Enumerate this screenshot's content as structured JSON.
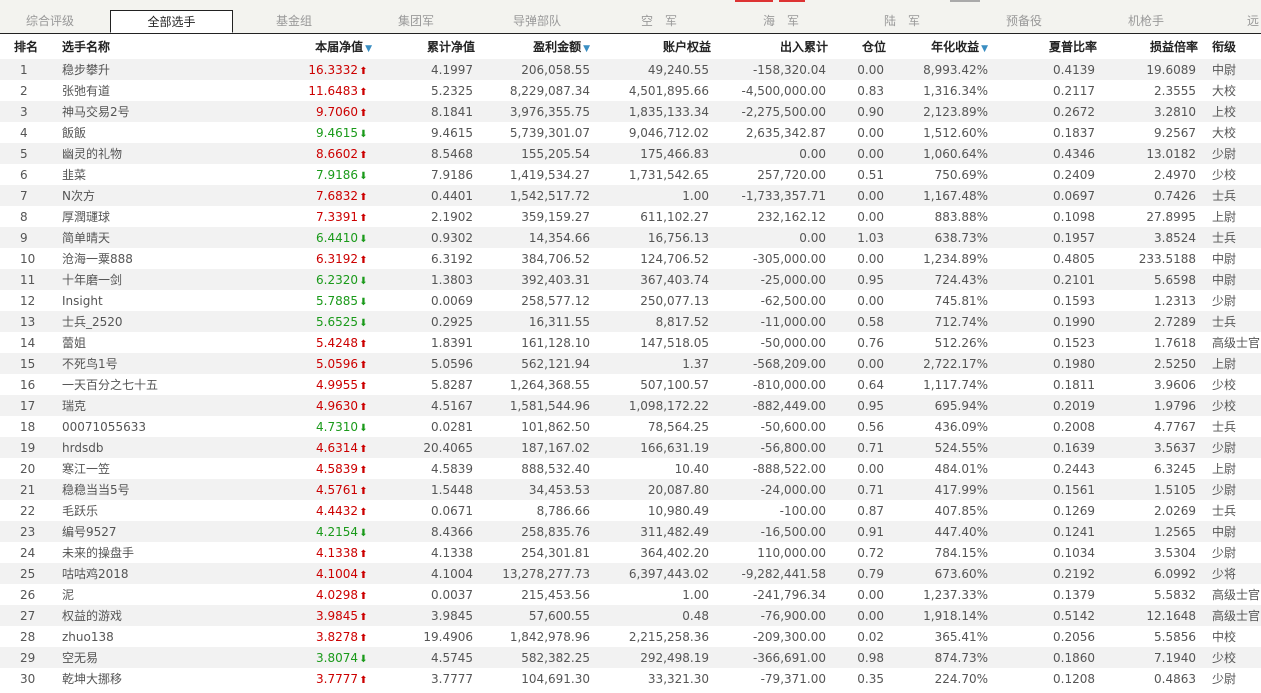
{
  "tabs": [
    {
      "label": "综合评级",
      "active": false
    },
    {
      "label": "全部选手",
      "active": true
    },
    {
      "label": "基金组",
      "active": false
    },
    {
      "label": "集团军",
      "active": false
    },
    {
      "label": "导弹部队",
      "active": false
    },
    {
      "label": "空　军",
      "active": false
    },
    {
      "label": "海　军",
      "active": false
    },
    {
      "label": "陆　军",
      "active": false
    },
    {
      "label": "预备役",
      "active": false
    },
    {
      "label": "机枪手",
      "active": false
    },
    {
      "label": "远",
      "active": false
    }
  ],
  "headers": {
    "rank": "排名",
    "name": "选手名称",
    "nav": "本届净值",
    "cum_nav": "累计净值",
    "profit": "盈利金额",
    "equity": "账户权益",
    "flow": "出入累计",
    "position": "仓位",
    "annual": "年化收益",
    "sharpe": "夏普比率",
    "ratio": "损益倍率",
    "grade": "衔级"
  },
  "colors": {
    "up": "#cc0000",
    "down": "#1a9a1a",
    "sort_icon": "#3a8ec2",
    "row_stripe": "#f2f2f2"
  },
  "rows": [
    {
      "rank": "1",
      "name": "稳步攀升",
      "nav": "16.3332",
      "dir": "up",
      "cum": "4.1997",
      "profit": "206,058.55",
      "equity": "49,240.55",
      "flow": "-158,320.04",
      "pos": "0.00",
      "annual": "8,993.42%",
      "sharpe": "0.4139",
      "ratio": "19.6089",
      "grade": "中尉"
    },
    {
      "rank": "2",
      "name": "张弛有道",
      "nav": "11.6483",
      "dir": "up",
      "cum": "5.2325",
      "profit": "8,229,087.34",
      "equity": "4,501,895.66",
      "flow": "-4,500,000.00",
      "pos": "0.83",
      "annual": "1,316.34%",
      "sharpe": "0.2117",
      "ratio": "2.3555",
      "grade": "大校"
    },
    {
      "rank": "3",
      "name": "神马交易2号",
      "nav": "9.7060",
      "dir": "up",
      "cum": "8.1841",
      "profit": "3,976,355.75",
      "equity": "1,835,133.34",
      "flow": "-2,275,500.00",
      "pos": "0.90",
      "annual": "2,123.89%",
      "sharpe": "0.2672",
      "ratio": "3.2810",
      "grade": "上校"
    },
    {
      "rank": "4",
      "name": "飯飯",
      "nav": "9.4615",
      "dir": "down",
      "cum": "9.4615",
      "profit": "5,739,301.07",
      "equity": "9,046,712.02",
      "flow": "2,635,342.87",
      "pos": "0.00",
      "annual": "1,512.60%",
      "sharpe": "0.1837",
      "ratio": "9.2567",
      "grade": "大校"
    },
    {
      "rank": "5",
      "name": "幽灵的礼物",
      "nav": "8.6602",
      "dir": "up",
      "cum": "8.5468",
      "profit": "155,205.54",
      "equity": "175,466.83",
      "flow": "0.00",
      "pos": "0.00",
      "annual": "1,060.64%",
      "sharpe": "0.4346",
      "ratio": "13.0182",
      "grade": "少尉"
    },
    {
      "rank": "6",
      "name": "韭菜",
      "nav": "7.9186",
      "dir": "down",
      "cum": "7.9186",
      "profit": "1,419,534.27",
      "equity": "1,731,542.65",
      "flow": "257,720.00",
      "pos": "0.51",
      "annual": "750.69%",
      "sharpe": "0.2409",
      "ratio": "2.4970",
      "grade": "少校"
    },
    {
      "rank": "7",
      "name": "N次方",
      "nav": "7.6832",
      "dir": "up",
      "cum": "0.4401",
      "profit": "1,542,517.72",
      "equity": "1.00",
      "flow": "-1,733,357.71",
      "pos": "0.00",
      "annual": "1,167.48%",
      "sharpe": "0.0697",
      "ratio": "0.7426",
      "grade": "士兵"
    },
    {
      "rank": "8",
      "name": "厚潤璭球",
      "nav": "7.3391",
      "dir": "up",
      "cum": "2.1902",
      "profit": "359,159.27",
      "equity": "611,102.27",
      "flow": "232,162.12",
      "pos": "0.00",
      "annual": "883.88%",
      "sharpe": "0.1098",
      "ratio": "27.8995",
      "grade": "上尉"
    },
    {
      "rank": "9",
      "name": "简单晴天",
      "nav": "6.4410",
      "dir": "down",
      "cum": "0.9302",
      "profit": "14,354.66",
      "equity": "16,756.13",
      "flow": "0.00",
      "pos": "1.03",
      "annual": "638.73%",
      "sharpe": "0.1957",
      "ratio": "3.8524",
      "grade": "士兵"
    },
    {
      "rank": "10",
      "name": "沧海一粟888",
      "nav": "6.3192",
      "dir": "up",
      "cum": "6.3192",
      "profit": "384,706.52",
      "equity": "124,706.52",
      "flow": "-305,000.00",
      "pos": "0.00",
      "annual": "1,234.89%",
      "sharpe": "0.4805",
      "ratio": "233.5188",
      "grade": "中尉"
    },
    {
      "rank": "11",
      "name": "十年磨一剑",
      "nav": "6.2320",
      "dir": "down",
      "cum": "1.3803",
      "profit": "392,403.31",
      "equity": "367,403.74",
      "flow": "-25,000.00",
      "pos": "0.95",
      "annual": "724.43%",
      "sharpe": "0.2101",
      "ratio": "5.6598",
      "grade": "中尉"
    },
    {
      "rank": "12",
      "name": "Insight",
      "nav": "5.7885",
      "dir": "down",
      "cum": "0.0069",
      "profit": "258,577.12",
      "equity": "250,077.13",
      "flow": "-62,500.00",
      "pos": "0.00",
      "annual": "745.81%",
      "sharpe": "0.1593",
      "ratio": "1.2313",
      "grade": "少尉"
    },
    {
      "rank": "13",
      "name": "士兵_2520",
      "nav": "5.6525",
      "dir": "down",
      "cum": "0.2925",
      "profit": "16,311.55",
      "equity": "8,817.52",
      "flow": "-11,000.00",
      "pos": "0.58",
      "annual": "712.74%",
      "sharpe": "0.1990",
      "ratio": "2.7289",
      "grade": "士兵"
    },
    {
      "rank": "14",
      "name": "蕾姐",
      "nav": "5.4248",
      "dir": "up",
      "cum": "1.8391",
      "profit": "161,128.10",
      "equity": "147,518.05",
      "flow": "-50,000.00",
      "pos": "0.76",
      "annual": "512.26%",
      "sharpe": "0.1523",
      "ratio": "1.7618",
      "grade": "高级士官"
    },
    {
      "rank": "15",
      "name": "不死鸟1号",
      "nav": "5.0596",
      "dir": "up",
      "cum": "5.0596",
      "profit": "562,121.94",
      "equity": "1.37",
      "flow": "-568,209.00",
      "pos": "0.00",
      "annual": "2,722.17%",
      "sharpe": "0.1980",
      "ratio": "2.5250",
      "grade": "上尉"
    },
    {
      "rank": "16",
      "name": "一天百分之七十五",
      "nav": "4.9955",
      "dir": "up",
      "cum": "5.8287",
      "profit": "1,264,368.55",
      "equity": "507,100.57",
      "flow": "-810,000.00",
      "pos": "0.64",
      "annual": "1,117.74%",
      "sharpe": "0.1811",
      "ratio": "3.9606",
      "grade": "少校"
    },
    {
      "rank": "17",
      "name": "瑞克",
      "nav": "4.9630",
      "dir": "up",
      "cum": "4.5167",
      "profit": "1,581,544.96",
      "equity": "1,098,172.22",
      "flow": "-882,449.00",
      "pos": "0.95",
      "annual": "695.94%",
      "sharpe": "0.2019",
      "ratio": "1.9796",
      "grade": "少校"
    },
    {
      "rank": "18",
      "name": "00071055633",
      "nav": "4.7310",
      "dir": "down",
      "cum": "0.0281",
      "profit": "101,862.50",
      "equity": "78,564.25",
      "flow": "-50,600.00",
      "pos": "0.56",
      "annual": "436.09%",
      "sharpe": "0.2008",
      "ratio": "4.7767",
      "grade": "士兵"
    },
    {
      "rank": "19",
      "name": "hrdsdb",
      "nav": "4.6314",
      "dir": "up",
      "cum": "20.4065",
      "profit": "187,167.02",
      "equity": "166,631.19",
      "flow": "-56,800.00",
      "pos": "0.71",
      "annual": "524.55%",
      "sharpe": "0.1639",
      "ratio": "3.5637",
      "grade": "少尉"
    },
    {
      "rank": "20",
      "name": "寒江一笠",
      "nav": "4.5839",
      "dir": "up",
      "cum": "4.5839",
      "profit": "888,532.40",
      "equity": "10.40",
      "flow": "-888,522.00",
      "pos": "0.00",
      "annual": "484.01%",
      "sharpe": "0.2443",
      "ratio": "6.3245",
      "grade": "上尉"
    },
    {
      "rank": "21",
      "name": "稳稳当当5号",
      "nav": "4.5761",
      "dir": "up",
      "cum": "1.5448",
      "profit": "34,453.53",
      "equity": "20,087.80",
      "flow": "-24,000.00",
      "pos": "0.71",
      "annual": "417.99%",
      "sharpe": "0.1561",
      "ratio": "1.5105",
      "grade": "少尉"
    },
    {
      "rank": "22",
      "name": "毛跃乐",
      "nav": "4.4432",
      "dir": "up",
      "cum": "0.0671",
      "profit": "8,786.66",
      "equity": "10,980.49",
      "flow": "-100.00",
      "pos": "0.87",
      "annual": "407.85%",
      "sharpe": "0.1269",
      "ratio": "2.0269",
      "grade": "士兵"
    },
    {
      "rank": "23",
      "name": "编号9527",
      "nav": "4.2154",
      "dir": "down",
      "cum": "8.4366",
      "profit": "258,835.76",
      "equity": "311,482.49",
      "flow": "-16,500.00",
      "pos": "0.91",
      "annual": "447.40%",
      "sharpe": "0.1241",
      "ratio": "1.2565",
      "grade": "中尉"
    },
    {
      "rank": "24",
      "name": "未来的操盘手",
      "nav": "4.1338",
      "dir": "up",
      "cum": "4.1338",
      "profit": "254,301.81",
      "equity": "364,402.20",
      "flow": "110,000.00",
      "pos": "0.72",
      "annual": "784.15%",
      "sharpe": "0.1034",
      "ratio": "3.5304",
      "grade": "少尉"
    },
    {
      "rank": "25",
      "name": "咕咕鸡2018",
      "nav": "4.1004",
      "dir": "up",
      "cum": "4.1004",
      "profit": "13,278,277.73",
      "equity": "6,397,443.02",
      "flow": "-9,282,441.58",
      "pos": "0.79",
      "annual": "673.60%",
      "sharpe": "0.2192",
      "ratio": "6.0992",
      "grade": "少将"
    },
    {
      "rank": "26",
      "name": "泥",
      "nav": "4.0298",
      "dir": "up",
      "cum": "0.0037",
      "profit": "215,453.56",
      "equity": "1.00",
      "flow": "-241,796.34",
      "pos": "0.00",
      "annual": "1,237.33%",
      "sharpe": "0.1379",
      "ratio": "5.5832",
      "grade": "高级士官"
    },
    {
      "rank": "27",
      "name": "权益的游戏",
      "nav": "3.9845",
      "dir": "up",
      "cum": "3.9845",
      "profit": "57,600.55",
      "equity": "0.48",
      "flow": "-76,900.00",
      "pos": "0.00",
      "annual": "1,918.14%",
      "sharpe": "0.5142",
      "ratio": "12.1648",
      "grade": "高级士官"
    },
    {
      "rank": "28",
      "name": "zhuo138",
      "nav": "3.8278",
      "dir": "up",
      "cum": "19.4906",
      "profit": "1,842,978.96",
      "equity": "2,215,258.36",
      "flow": "-209,300.00",
      "pos": "0.02",
      "annual": "365.41%",
      "sharpe": "0.2056",
      "ratio": "5.5856",
      "grade": "中校"
    },
    {
      "rank": "29",
      "name": "空无易",
      "nav": "3.8074",
      "dir": "down",
      "cum": "4.5745",
      "profit": "582,382.25",
      "equity": "292,498.19",
      "flow": "-366,691.00",
      "pos": "0.98",
      "annual": "874.73%",
      "sharpe": "0.1860",
      "ratio": "7.1940",
      "grade": "少校"
    },
    {
      "rank": "30",
      "name": "乾坤大挪移",
      "nav": "3.7777",
      "dir": "up",
      "cum": "3.7777",
      "profit": "104,691.30",
      "equity": "33,321.30",
      "flow": "-79,371.00",
      "pos": "0.35",
      "annual": "224.70%",
      "sharpe": "0.1208",
      "ratio": "0.4863",
      "grade": "少尉"
    }
  ]
}
